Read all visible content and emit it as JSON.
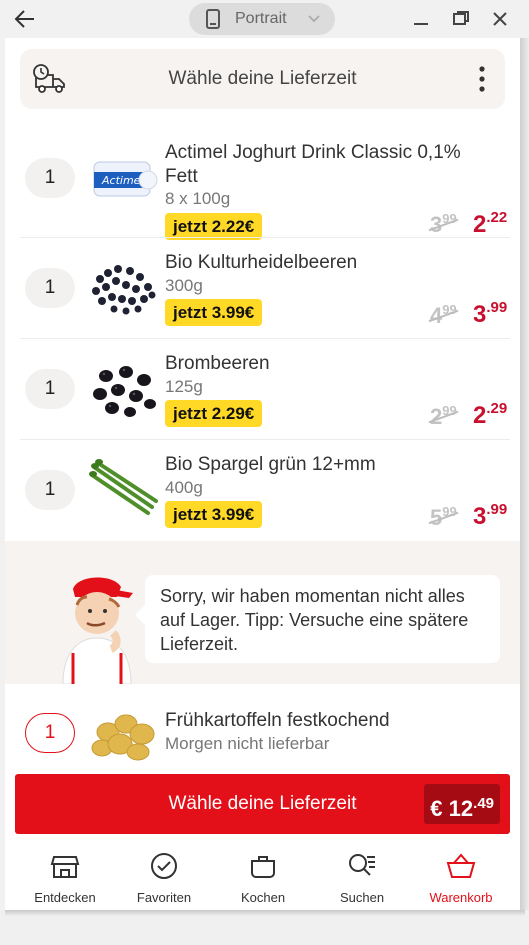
{
  "window": {
    "orientation_label": "Portrait",
    "icons": [
      "arrow-left-icon",
      "phone-icon",
      "chevron-down-icon",
      "minimize-icon",
      "restore-icon",
      "close-icon"
    ]
  },
  "header": {
    "title": "Wähle deine Lieferzeit",
    "icons": [
      "delivery-truck-clock-icon",
      "more-vertical-icon"
    ]
  },
  "items": [
    {
      "qty": "1",
      "name": "Actimel Joghurt Drink Classic 0,1% Fett",
      "size": "8 x 100g",
      "deal": "jetzt 2.22€",
      "old_int": "3",
      "old_dec": "99",
      "new_int": "2",
      "new_dec": "22"
    },
    {
      "qty": "1",
      "name": "Bio Kulturheidelbeeren",
      "size": "300g",
      "deal": "jetzt 3.99€",
      "old_int": "4",
      "old_dec": "99",
      "new_int": "3",
      "new_dec": "99"
    },
    {
      "qty": "1",
      "name": "Brombeeren",
      "size": "125g",
      "deal": "jetzt 2.29€",
      "old_int": "2",
      "old_dec": "99",
      "new_int": "2",
      "new_dec": "29"
    },
    {
      "qty": "1",
      "name": "Bio Spargel grün 12+mm",
      "size": "400g",
      "deal": "jetzt 3.99€",
      "old_int": "5",
      "old_dec": "99",
      "new_int": "3",
      "new_dec": "99"
    }
  ],
  "notice": {
    "text": "Sorry, wir haben momentan nicht alles auf Lager. Tipp: Versuche eine spätere Lieferzeit."
  },
  "unavailable": {
    "qty": "1",
    "name": "Frühkartoffeln festkochend",
    "status": "Morgen nicht lieferbar"
  },
  "cta": {
    "label": "Wähle deine Lieferzeit",
    "total_currency": "€",
    "total_int": "12",
    "total_dec": "49"
  },
  "nav": [
    {
      "label": "Entdecken",
      "icon": "store-icon"
    },
    {
      "label": "Favoriten",
      "icon": "check-circle-icon"
    },
    {
      "label": "Kochen",
      "icon": "cooking-pot-icon"
    },
    {
      "label": "Suchen",
      "icon": "search-list-icon"
    },
    {
      "label": "Warenkorb",
      "icon": "basket-icon"
    }
  ],
  "colors": {
    "accent": "#e3101a",
    "price": "#c8102e",
    "deal": "#ffd926"
  }
}
